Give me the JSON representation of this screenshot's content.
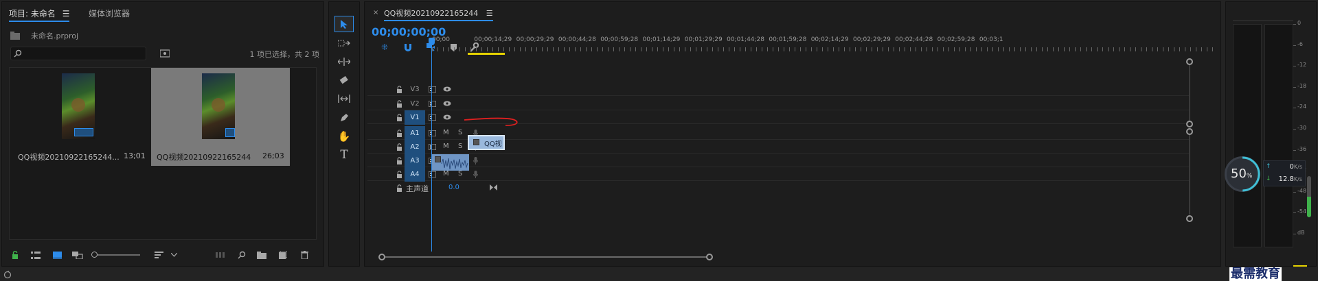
{
  "project": {
    "tab_project": "项目: 未命名",
    "tab_media_browser": "媒体浏览器",
    "file_name": "未命名.prproj",
    "selection_text": "1 项已选择，共 2 项",
    "items": [
      {
        "name": "QQ视频20210922165244...",
        "duration": "13;01"
      },
      {
        "name": "QQ视频20210922165244",
        "duration": "26;03"
      }
    ]
  },
  "timeline": {
    "sequence_tab": "QQ视频20210922165244",
    "timecode": "00;00;00;00",
    "ruler_ticks": [
      "00;00",
      "00;00;14;29",
      "00;00;29;29",
      "00;00;44;28",
      "00;00;59;28",
      "00;01;14;29",
      "00;01;29;29",
      "00;01;44;28",
      "00;01;59;28",
      "00;02;14;29",
      "00;02;29;29",
      "00;02;44;28",
      "00;02;59;28",
      "00;03;1"
    ],
    "video_tracks": [
      {
        "id": "V3",
        "label": "V3"
      },
      {
        "id": "V2",
        "label": "V2"
      },
      {
        "id": "V1",
        "label": "V1"
      }
    ],
    "audio_tracks": [
      {
        "id": "A1",
        "label": "A1"
      },
      {
        "id": "A2",
        "label": "A2"
      },
      {
        "id": "A3",
        "label": "A3"
      },
      {
        "id": "A4",
        "label": "A4"
      }
    ],
    "mute_label": "M",
    "solo_label": "S",
    "master_label": "主声道",
    "master_value": "0.0",
    "video_clip_label": "QQ视"
  },
  "meter": {
    "scale": [
      "0",
      "-6",
      "-12",
      "-18",
      "-24",
      "-30",
      "-36",
      "-42",
      "-48",
      "-54",
      "dB"
    ]
  },
  "network_widget": {
    "percent": "50",
    "percent_unit": "%",
    "upload_value": "0",
    "upload_unit": "K/s",
    "download_value": "12.8",
    "download_unit": "K/s"
  },
  "watermark": "最需教育",
  "colors": {
    "accent": "#2d8ceb",
    "clip_video": "#9ab9dd",
    "clip_audio": "#6f95c4",
    "playhead": "#2d8ceb",
    "work_area": "#e6d300",
    "annotation": "#e02020"
  }
}
